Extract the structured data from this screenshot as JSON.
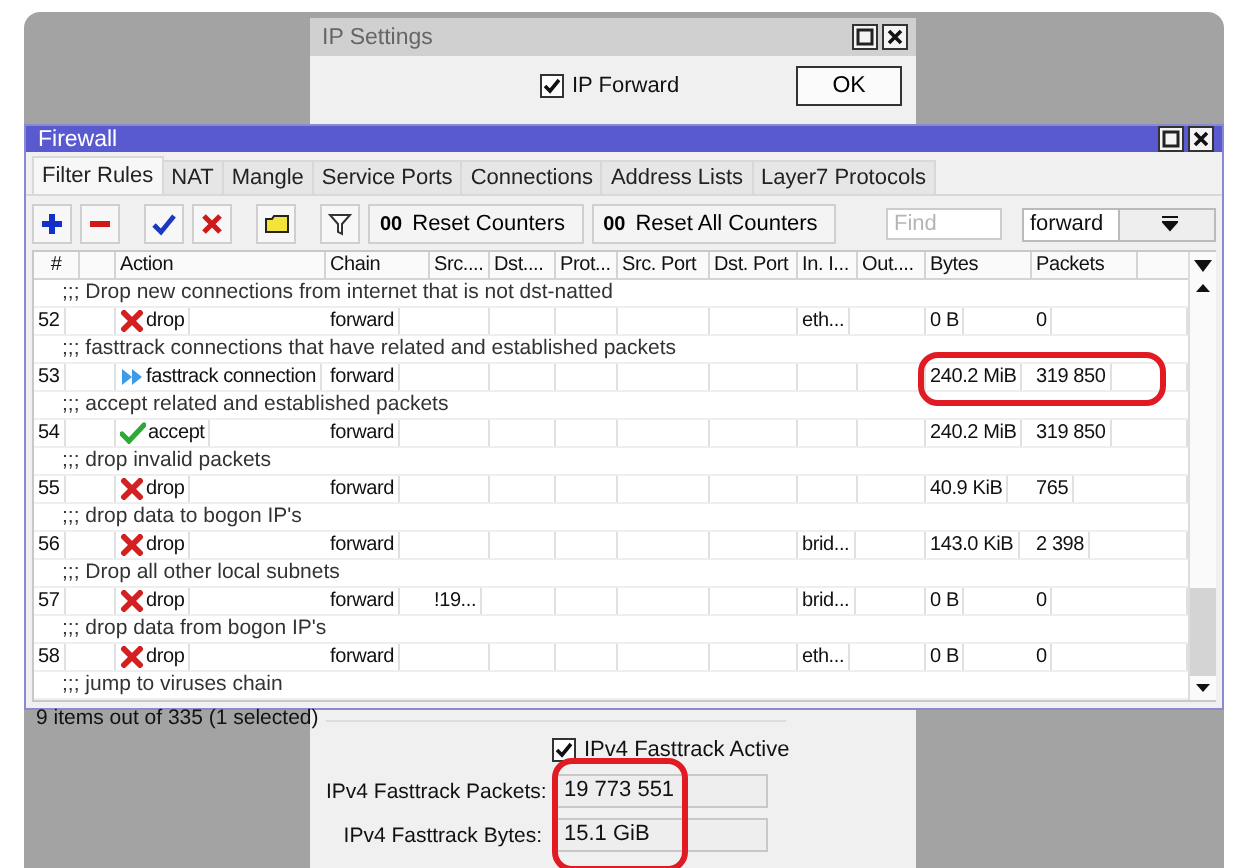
{
  "ip_settings": {
    "title": "IP Settings",
    "ip_forward": {
      "label": "IP Forward",
      "checked": true
    },
    "ok_button": "OK",
    "fasttrack_active": {
      "label": "IPv4 Fasttrack Active",
      "checked": true
    },
    "fields": [
      {
        "label": "IPv4 Fasttrack Packets:",
        "value": "19 773 551"
      },
      {
        "label": "IPv4 Fasttrack Bytes:",
        "value": "15.1 GiB"
      }
    ],
    "fields_highlighted": true
  },
  "firewall": {
    "title": "Firewall",
    "tabs": [
      {
        "label": "Filter Rules",
        "selected": true
      },
      {
        "label": "NAT",
        "selected": false
      },
      {
        "label": "Mangle",
        "selected": false
      },
      {
        "label": "Service Ports",
        "selected": false
      },
      {
        "label": "Connections",
        "selected": false
      },
      {
        "label": "Address Lists",
        "selected": false
      },
      {
        "label": "Layer7 Protocols",
        "selected": false
      }
    ],
    "toolbar": {
      "reset_buttons": [
        {
          "glyph": "00",
          "label": "Reset Counters"
        },
        {
          "glyph": "00",
          "label": "Reset All Counters"
        }
      ],
      "find": {
        "placeholder": "Find"
      },
      "chain_filter": "forward"
    },
    "columns": [
      "#",
      "Action",
      "Chain",
      "Src....",
      "Dst....",
      "Prot...",
      "Src. Port",
      "Dst. Port",
      "In. I...",
      "Out....",
      "Bytes",
      "Packets"
    ],
    "rows": [
      {
        "kind": "comment",
        "text": ";;; Drop new connections from internet that is not dst-natted"
      },
      {
        "kind": "rule",
        "number": "52",
        "action": {
          "kind": "drop",
          "label": "drop"
        },
        "chain": "forward",
        "in_interface": "eth...",
        "bytes": "0 B",
        "packets": "0",
        "highlighted": false
      },
      {
        "kind": "comment",
        "text": ";;; fasttrack connections that have related and established packets"
      },
      {
        "kind": "rule",
        "number": "53",
        "action": {
          "kind": "fasttrack",
          "label": "fasttrack connection"
        },
        "chain": "forward",
        "bytes": "240.2 MiB",
        "packets": "319 850",
        "highlighted": true
      },
      {
        "kind": "comment",
        "text": ";;; accept related and established packets"
      },
      {
        "kind": "rule",
        "number": "54",
        "action": {
          "kind": "accept",
          "label": "accept"
        },
        "chain": "forward",
        "bytes": "240.2 MiB",
        "packets": "319 850",
        "highlighted": false
      },
      {
        "kind": "comment",
        "text": ";;; drop invalid packets"
      },
      {
        "kind": "rule",
        "number": "55",
        "action": {
          "kind": "drop",
          "label": "drop"
        },
        "chain": "forward",
        "bytes": "40.9 KiB",
        "packets": "765",
        "highlighted": false
      },
      {
        "kind": "comment",
        "text": ";;; drop data to bogon IP's"
      },
      {
        "kind": "rule",
        "number": "56",
        "action": {
          "kind": "drop",
          "label": "drop"
        },
        "chain": "forward",
        "in_interface": "brid...",
        "bytes": "143.0 KiB",
        "packets": "2 398",
        "highlighted": false
      },
      {
        "kind": "comment",
        "text": ";;; Drop all other local subnets"
      },
      {
        "kind": "rule",
        "number": "57",
        "action": {
          "kind": "drop",
          "label": "drop"
        },
        "chain": "forward",
        "src_address": "!19...",
        "in_interface": "brid...",
        "bytes": "0 B",
        "packets": "0",
        "highlighted": false
      },
      {
        "kind": "comment",
        "text": ";;; drop data from bogon IP's"
      },
      {
        "kind": "rule",
        "number": "58",
        "action": {
          "kind": "drop",
          "label": "drop"
        },
        "chain": "forward",
        "in_interface": "eth...",
        "bytes": "0 B",
        "packets": "0",
        "highlighted": false
      },
      {
        "kind": "comment",
        "text": ";;; jump to viruses chain"
      }
    ],
    "status": "9 items out of 335 (1 selected)"
  }
}
